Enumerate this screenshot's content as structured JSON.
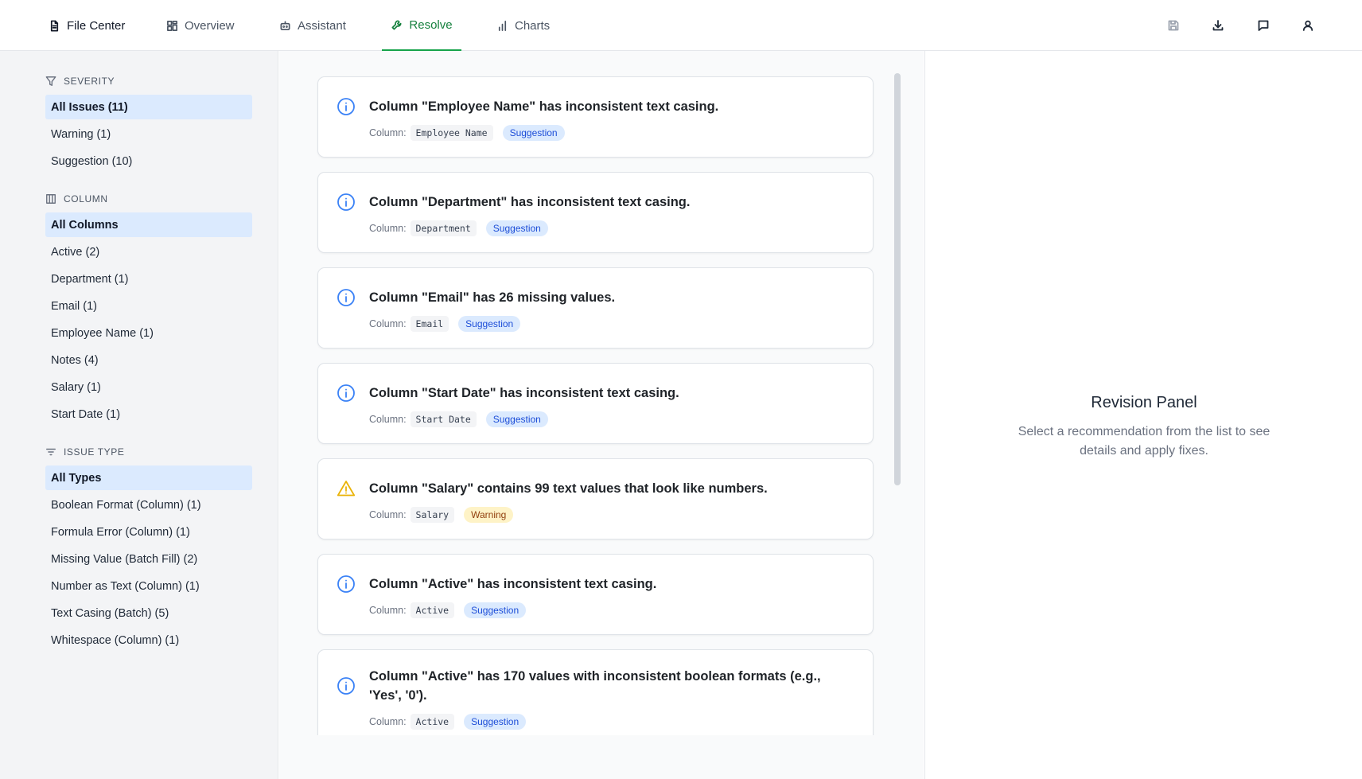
{
  "nav": {
    "tabs": [
      {
        "label": "File Center",
        "icon": "file-icon"
      },
      {
        "label": "Overview",
        "icon": "dashboard-icon"
      },
      {
        "label": "Assistant",
        "icon": "bot-icon"
      },
      {
        "label": "Resolve",
        "icon": "wrench-icon",
        "active": true
      },
      {
        "label": "Charts",
        "icon": "bar-chart-icon"
      }
    ],
    "actions": [
      "save-icon",
      "download-icon",
      "comment-icon",
      "user-icon"
    ],
    "accent_color": "#16a34a"
  },
  "sidebar": {
    "severity": {
      "heading": "SEVERITY",
      "items": [
        {
          "label": "All Issues (11)",
          "active": true
        },
        {
          "label": "Warning (1)"
        },
        {
          "label": "Suggestion (10)"
        }
      ]
    },
    "column": {
      "heading": "COLUMN",
      "items": [
        {
          "label": "All Columns",
          "active": true
        },
        {
          "label": "Active (2)"
        },
        {
          "label": "Department (1)"
        },
        {
          "label": "Email (1)"
        },
        {
          "label": "Employee Name (1)"
        },
        {
          "label": "Notes (4)"
        },
        {
          "label": "Salary (1)"
        },
        {
          "label": "Start Date (1)"
        }
      ]
    },
    "issue_type": {
      "heading": "ISSUE TYPE",
      "items": [
        {
          "label": "All Types",
          "active": true
        },
        {
          "label": "Boolean Format (Column) (1)"
        },
        {
          "label": "Formula Error (Column) (1)"
        },
        {
          "label": "Missing Value (Batch Fill) (2)"
        },
        {
          "label": "Number as Text (Column) (1)"
        },
        {
          "label": "Text Casing (Batch) (5)"
        },
        {
          "label": "Whitespace (Column) (1)"
        }
      ]
    }
  },
  "issues": {
    "column_label": "Column:",
    "items": [
      {
        "title": "Column \"Employee Name\" has inconsistent text casing.",
        "column": "Employee Name",
        "severity": "Suggestion",
        "icon": "info-icon"
      },
      {
        "title": "Column \"Department\" has inconsistent text casing.",
        "column": "Department",
        "severity": "Suggestion",
        "icon": "info-icon"
      },
      {
        "title": "Column \"Email\" has 26 missing values.",
        "column": "Email",
        "severity": "Suggestion",
        "icon": "info-icon"
      },
      {
        "title": "Column \"Start Date\" has inconsistent text casing.",
        "column": "Start Date",
        "severity": "Suggestion",
        "icon": "info-icon"
      },
      {
        "title": "Column \"Salary\" contains 99 text values that look like numbers.",
        "column": "Salary",
        "severity": "Warning",
        "icon": "warning-icon"
      },
      {
        "title": "Column \"Active\" has inconsistent text casing.",
        "column": "Active",
        "severity": "Suggestion",
        "icon": "info-icon"
      },
      {
        "title": "Column \"Active\" has 170 values with inconsistent boolean formats (e.g., 'Yes', '0').",
        "column": "Active",
        "severity": "Suggestion",
        "icon": "info-icon"
      }
    ]
  },
  "revision_panel": {
    "title": "Revision Panel",
    "description": "Select a recommendation from the list to see details and apply fixes."
  }
}
